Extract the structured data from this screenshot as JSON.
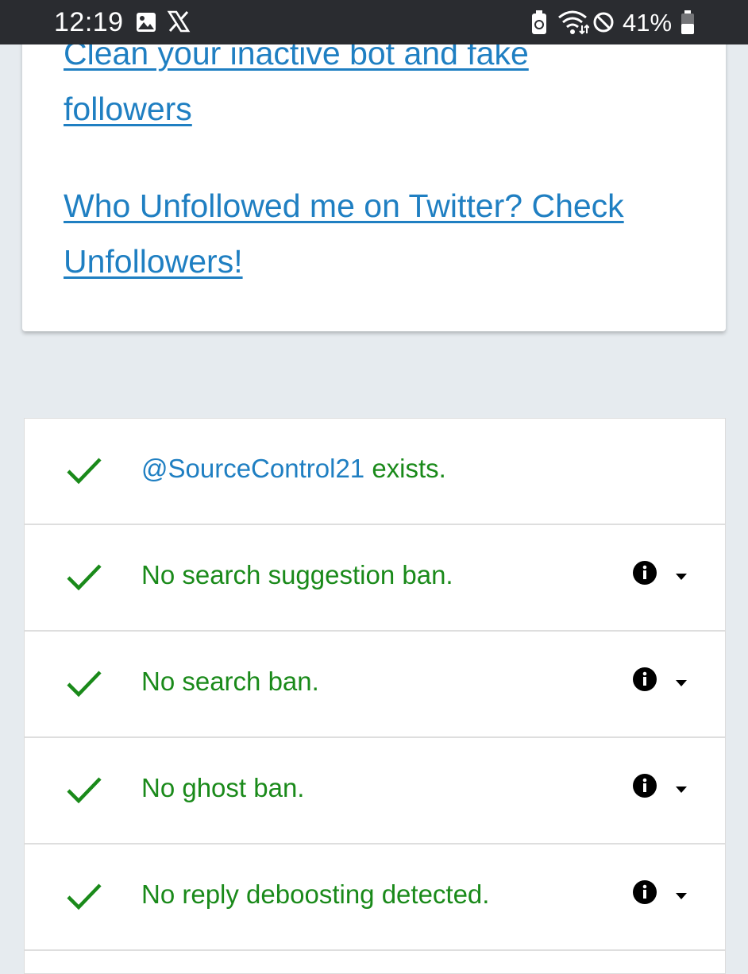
{
  "status_bar": {
    "time": "12:19",
    "battery": "41%",
    "icons": [
      "image-icon",
      "x-logo-icon",
      "battery-saver-icon",
      "wifi-icon",
      "do-not-disturb-icon",
      "battery-icon"
    ]
  },
  "links": [
    {
      "text": "Clean your inactive bot and fake followers"
    },
    {
      "text": "Who Unfollowed me on Twitter? Check Unfollowers!"
    }
  ],
  "results": [
    {
      "handle": "@SourceControl21",
      "text": " exists.",
      "status": "ok"
    },
    {
      "text": "No search suggestion ban.",
      "status": "ok"
    },
    {
      "text": "No search ban.",
      "status": "ok"
    },
    {
      "text": "No ghost ban.",
      "status": "ok"
    },
    {
      "text": "No reply deboosting detected.",
      "status": "ok"
    }
  ],
  "colors": {
    "ok_green": "#1a8a1a",
    "link_blue": "#1f7fc2",
    "page_bg": "#e6ebef"
  }
}
